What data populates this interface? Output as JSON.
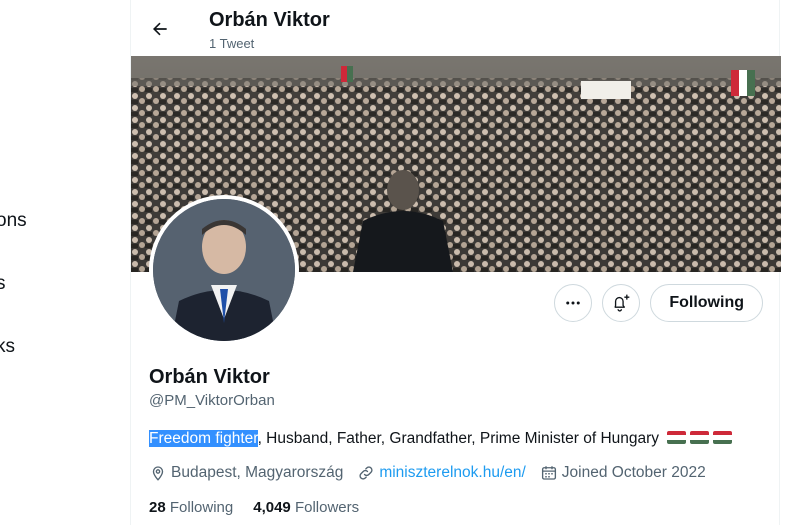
{
  "left_nav": {
    "items": [
      "ons",
      "s",
      "ks"
    ]
  },
  "header": {
    "back_icon": "arrow-left-icon",
    "name": "Orbán Viktor",
    "tweet_count": "1 Tweet"
  },
  "profile": {
    "name": "Orbán Viktor",
    "handle": "@PM_ViktorOrban",
    "bio_highlighted": "Freedom fighter",
    "bio_rest": ", Husband, Father, Grandfather, Prime Minister of Hungary",
    "location": "Budapest, Magyarország",
    "website": "miniszterelnok.hu/en/",
    "joined": "Joined October 2022",
    "following_count": "28",
    "following_label": "Following",
    "followers_count": "4,049",
    "followers_label": "Followers"
  },
  "actions": {
    "more_icon": "more-icon",
    "notify_icon": "bell-plus-icon",
    "follow_label": "Following"
  },
  "colors": {
    "accent": "#1d9bf0",
    "selection": "#3390ff",
    "flag_red": "#ce2939",
    "flag_white": "#ffffff",
    "flag_green": "#477050"
  }
}
